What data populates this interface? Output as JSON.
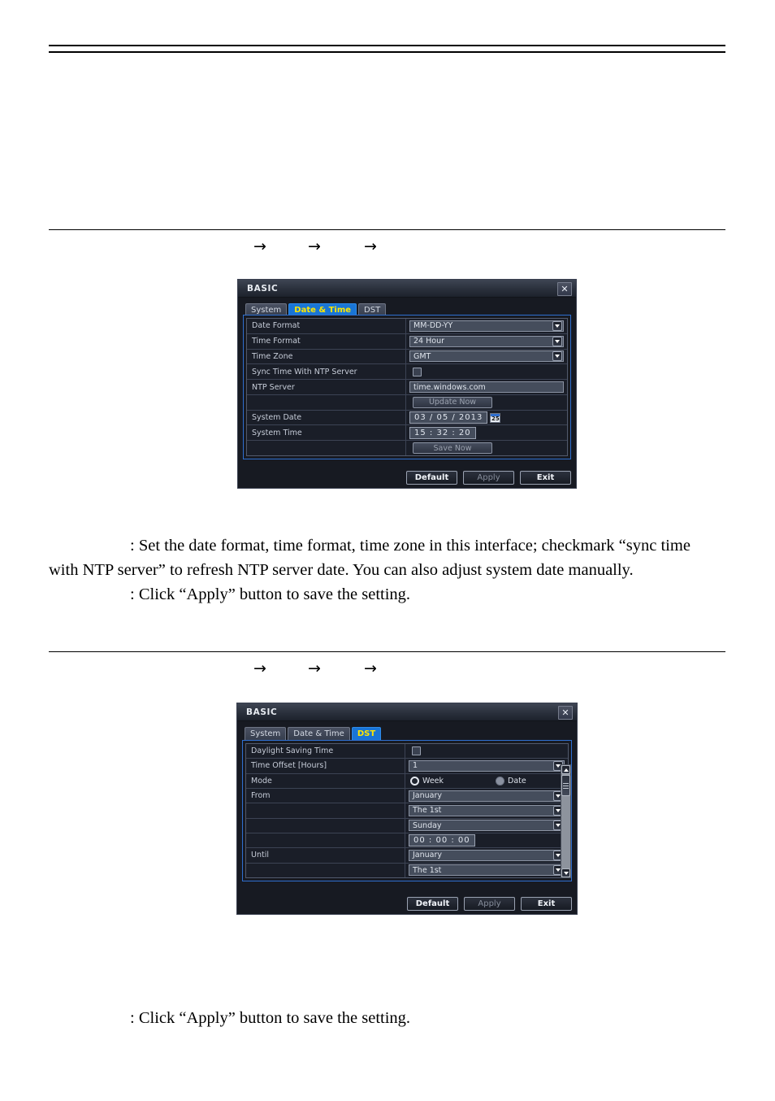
{
  "document": {
    "arrows": {
      "glyph": "→",
      "count": 3
    },
    "paragraphs": {
      "desc_1_line1": ": Set the date format, time format, time zone in this interface; checkmark “sync time",
      "desc_1_line2": "with NTP server” to refresh NTP server date. You can also adjust system date manually.",
      "apply_note_1": ": Click “Apply” button to save the setting.",
      "apply_note_2": ": Click “Apply” button to save the setting."
    }
  },
  "dialog_date_time": {
    "title": "BASIC",
    "close_icon": "✕",
    "tabs": [
      {
        "label": "System",
        "active": false
      },
      {
        "label": "Date & Time",
        "active": true
      },
      {
        "label": "DST",
        "active": false
      }
    ],
    "rows": {
      "date_format": {
        "label": "Date Format",
        "value": "MM-DD-YY"
      },
      "time_format": {
        "label": "Time Format",
        "value": "24 Hour"
      },
      "time_zone": {
        "label": "Time Zone",
        "value": "GMT"
      },
      "sync_ntp": {
        "label": "Sync Time With NTP Server",
        "checked": false
      },
      "ntp_server": {
        "label": "NTP Server",
        "value": "time.windows.com"
      },
      "update_now": {
        "label": "",
        "button": "Update Now"
      },
      "system_date": {
        "label": "System Date",
        "value": "03 / 05 / 2013",
        "calendar_day": "25"
      },
      "system_time": {
        "label": "System Time",
        "value": "15 : 32 : 20"
      },
      "save_now": {
        "label": "",
        "button": "Save Now"
      }
    },
    "buttons": {
      "default": "Default",
      "apply": "Apply",
      "exit": "Exit"
    }
  },
  "dialog_dst": {
    "title": "BASIC",
    "close_icon": "✕",
    "tabs": [
      {
        "label": "System",
        "active": false
      },
      {
        "label": "Date & Time",
        "active": false
      },
      {
        "label": "DST",
        "active": true
      }
    ],
    "rows": {
      "daylight_saving": {
        "label": "Daylight Saving Time",
        "checked": false
      },
      "time_offset": {
        "label": "Time Offset [Hours]",
        "value": "1"
      },
      "mode": {
        "label": "Mode",
        "option_week": "Week",
        "option_date": "Date",
        "selected": "Week"
      },
      "from_month": {
        "label": "From",
        "value": "January"
      },
      "from_week": {
        "label": "",
        "value": "The 1st"
      },
      "from_day": {
        "label": "",
        "value": "Sunday"
      },
      "from_time": {
        "label": "",
        "value": "00 : 00 : 00"
      },
      "until_month": {
        "label": "Until",
        "value": "January"
      },
      "until_week": {
        "label": "",
        "value": "The 1st"
      }
    },
    "buttons": {
      "default": "Default",
      "apply": "Apply",
      "exit": "Exit"
    }
  },
  "colors": {
    "accent_blue": "#1975d6",
    "active_tab_text": "#ffe600",
    "panel_border": "#2f6fd0",
    "window_bg": "#171a22"
  }
}
